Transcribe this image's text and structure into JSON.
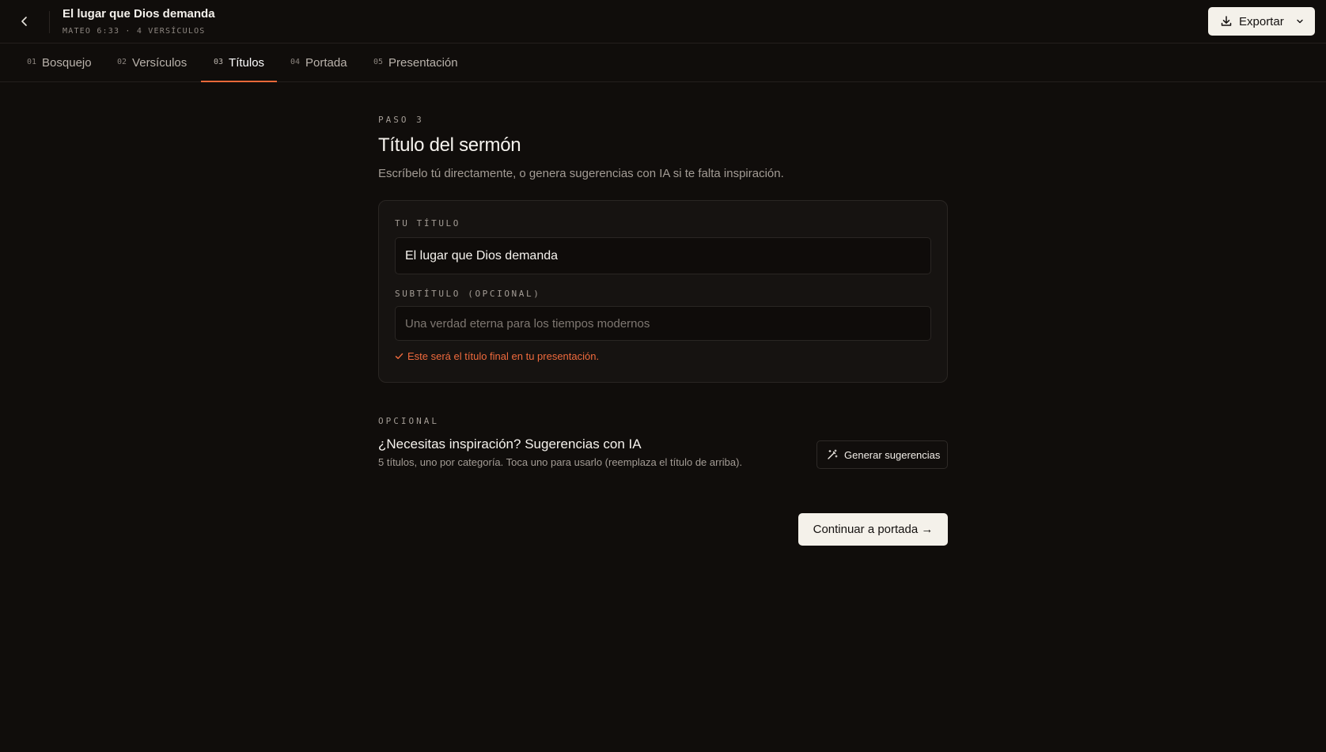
{
  "header": {
    "title": "El lugar que Dios demanda",
    "meta": "MATEO 6:33 · 4 VERSÍCULOS",
    "export_label": "Exportar"
  },
  "tabs": [
    {
      "num": "01",
      "label": "Bosquejo",
      "active": false
    },
    {
      "num": "02",
      "label": "Versículos",
      "active": false
    },
    {
      "num": "03",
      "label": "Títulos",
      "active": true
    },
    {
      "num": "04",
      "label": "Portada",
      "active": false
    },
    {
      "num": "05",
      "label": "Presentación",
      "active": false
    }
  ],
  "main": {
    "step_label": "PASO 3",
    "title": "Título del sermón",
    "description": "Escríbelo tú directamente, o genera sugerencias con IA si te falta inspiración."
  },
  "card": {
    "title_label": "TU TÍTULO",
    "title_value": "El lugar que Dios demanda",
    "subtitle_label": "SUBTÍTULO (OPCIONAL)",
    "subtitle_placeholder": "Una verdad eterna para los tiempos modernos",
    "hint": "Este será el título final en tu presentación."
  },
  "suggestions": {
    "label": "OPCIONAL",
    "title": "¿Necesitas inspiración? Sugerencias con IA",
    "description": "5 títulos, uno por categoría. Toca uno para usarlo (reemplaza el título de arriba).",
    "button_label": "Generar sugerencias"
  },
  "continue_label": "Continuar a portada →",
  "colors": {
    "background": "#100d0b",
    "accent": "#e8683a",
    "button_light": "#f4f1ea"
  },
  "icons": [
    "chevron-left-icon",
    "download-icon",
    "chevron-down-icon",
    "check-icon",
    "magic-wand-icon"
  ]
}
